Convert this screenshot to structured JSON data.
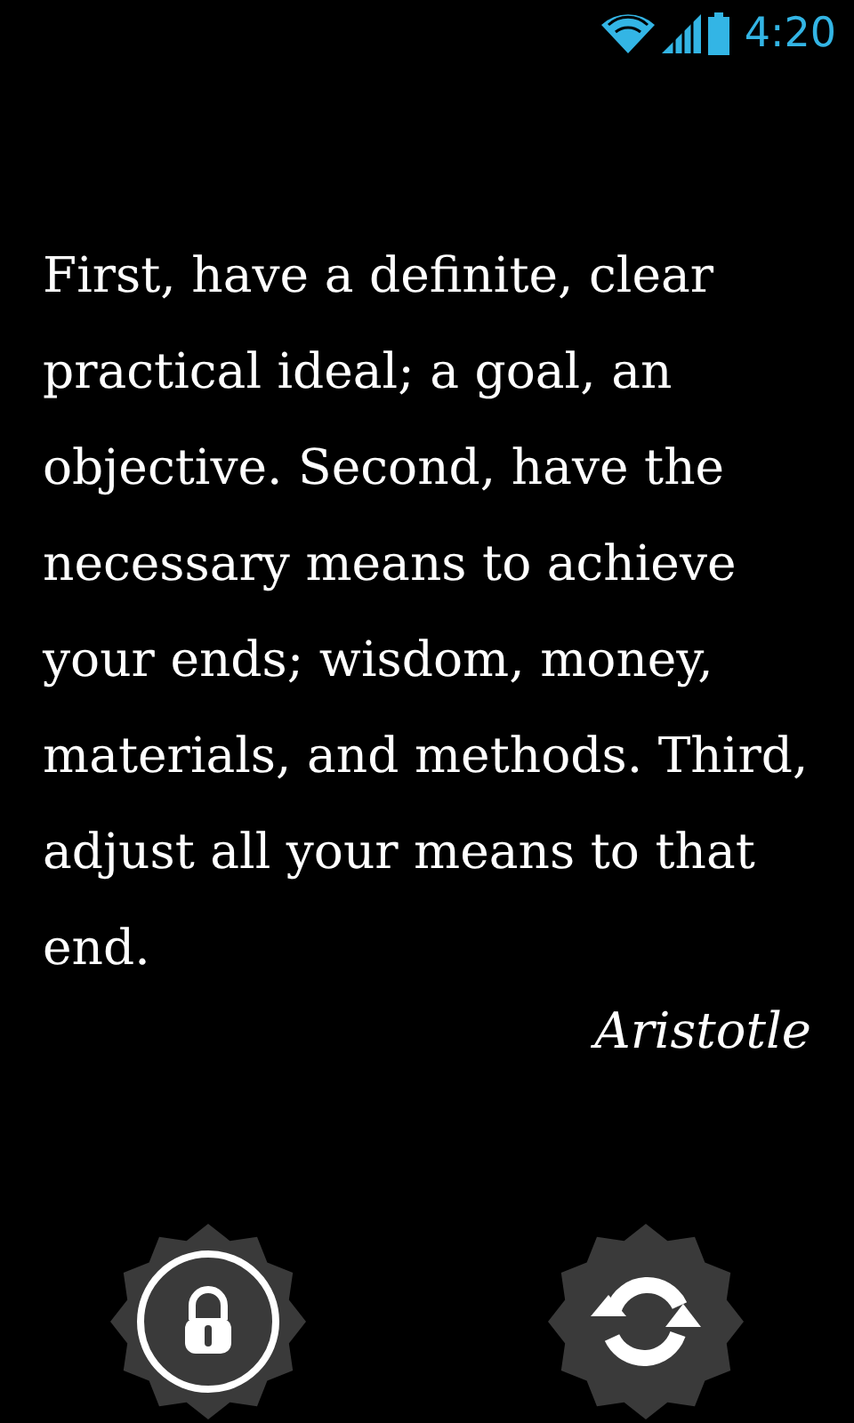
{
  "status_bar": {
    "time": "4:20"
  },
  "quote": {
    "text": "First, have a definite, clear practical ideal; a goal, an objective. Second, have the necessary means to achieve your ends; wisdom, money, materials, and methods. Third, adjust all your means to that end.",
    "author": "Aristotle"
  },
  "buttons": [
    {
      "kind": "lock"
    },
    {
      "kind": "refresh"
    }
  ]
}
